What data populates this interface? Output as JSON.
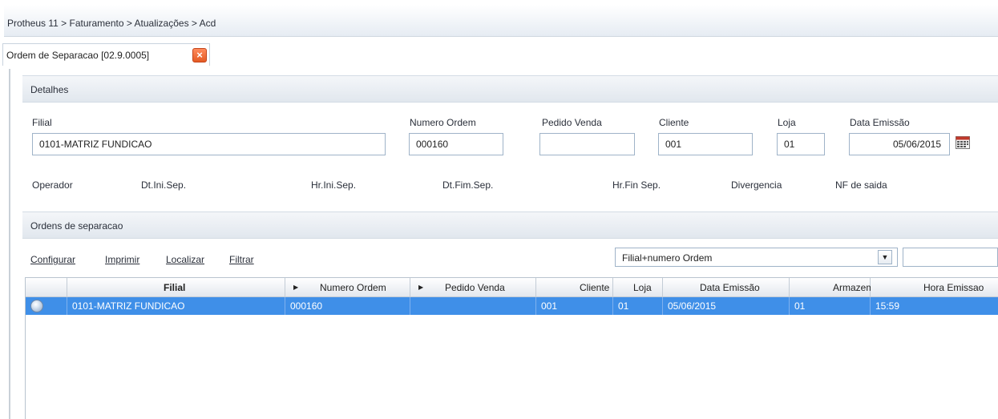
{
  "breadcrumb": "Protheus 11 > Faturamento > Atualizações > Acd",
  "tab": {
    "label": "Ordem de Separacao [02.9.0005]",
    "close_icon": "close-icon"
  },
  "detalhes": {
    "title": "Detalhes",
    "fields": {
      "filial": {
        "label": "Filial",
        "value": "0101-MATRIZ FUNDICAO"
      },
      "numero_ordem": {
        "label": "Numero Ordem",
        "value": "000160"
      },
      "pedido_venda": {
        "label": "Pedido Venda",
        "value": ""
      },
      "cliente": {
        "label": "Cliente",
        "value": "001"
      },
      "loja": {
        "label": "Loja",
        "value": "01"
      },
      "data_emissao": {
        "label": "Data Emissão",
        "value": "05/06/2015"
      }
    },
    "labels_row2": {
      "operador": "Operador",
      "dt_ini_sep": "Dt.Ini.Sep.",
      "hr_ini_sep": "Hr.Ini.Sep.",
      "dt_fim_sep": "Dt.Fim.Sep.",
      "hr_fin_sep": "Hr.Fin Sep.",
      "divergencia": "Divergencia",
      "nf_saida": "NF de saida"
    }
  },
  "ordens": {
    "title": "Ordens de separacao",
    "toolbar": {
      "configurar": "Configurar",
      "imprimir": "Imprimir",
      "localizar": "Localizar",
      "filtrar": "Filtrar",
      "order_select": "Filial+numero Ordem",
      "search_value": ""
    },
    "columns": [
      "",
      "Filial",
      "Numero Ordem",
      "Pedido Venda",
      "Cliente",
      "Loja",
      "Data Emissão",
      "Armazem",
      "Hora Emissao"
    ],
    "rows": [
      {
        "filial": "0101-MATRIZ FUNDICAO",
        "numero_ordem": "000160",
        "pedido_venda": "",
        "cliente": "001",
        "loja": "01",
        "data_emissao": "05/06/2015",
        "armazem": "01",
        "hora_emissao": "15:59"
      }
    ]
  },
  "colors": {
    "selection": "#3f8fe8",
    "close_button": "#e45a24"
  }
}
